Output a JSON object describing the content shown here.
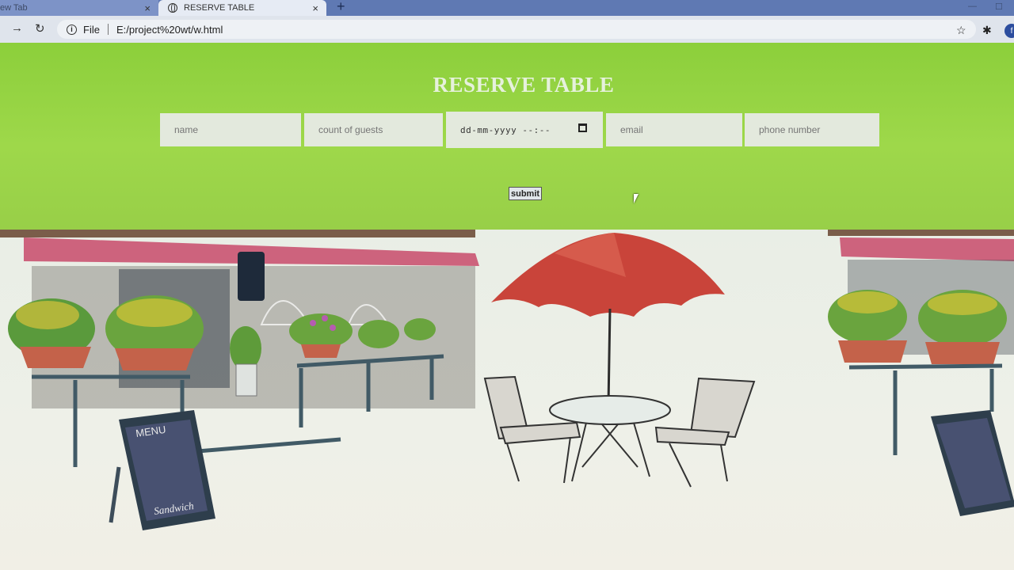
{
  "browser": {
    "tabs": [
      {
        "label": "ew Tab",
        "active": false
      },
      {
        "label": "RESERVE TABLE",
        "active": true
      }
    ],
    "close_glyph": "×",
    "new_tab_glyph": "+",
    "address": {
      "scheme_label": "File",
      "url": "E:/project%20wt/w.html"
    },
    "profile_initial": "f"
  },
  "form": {
    "title": "RESERVE TABLE",
    "placeholders": {
      "name": "name",
      "guests": "count of guests",
      "email": "email",
      "phone": "phone number"
    },
    "date_placeholder": "dd-mm-yyyy --:--",
    "submit_label": "submit"
  },
  "colors": {
    "header_green": "#9ed84a",
    "title_text": "#e6f1dc",
    "field_bg": "#e3e9dd",
    "umbrella_red": "#c9443a",
    "awning_pink": "#c84a6a"
  },
  "illustration": {
    "menu_board_heading": "MENU",
    "menu_board_footer": "Sandwich"
  }
}
